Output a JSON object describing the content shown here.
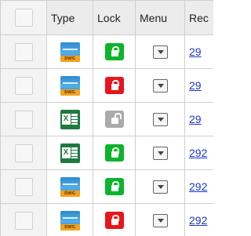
{
  "headers": {
    "select": "",
    "type": "Type",
    "lock": "Lock",
    "menu": "Menu",
    "rec": "Rec"
  },
  "rows": [
    {
      "type": "dwg-icon",
      "type_label": "DWG",
      "lock": "locked",
      "lock_color": "#0bb52a",
      "rec": "29"
    },
    {
      "type": "dwg-icon",
      "type_label": "DWG",
      "lock": "locked",
      "lock_color": "#e6161c",
      "rec": "29"
    },
    {
      "type": "excel-icon",
      "type_label": "X",
      "lock": "unlocked",
      "lock_color": "#aaaaaa",
      "rec": "29"
    },
    {
      "type": "excel-icon",
      "type_label": "X",
      "lock": "locked",
      "lock_color": "#0bb52a",
      "rec": "292"
    },
    {
      "type": "dwg-icon",
      "type_label": "DWG",
      "lock": "locked",
      "lock_color": "#0bb52a",
      "rec": "292"
    },
    {
      "type": "dwg-icon",
      "type_label": "DWG",
      "lock": "locked",
      "lock_color": "#e6161c",
      "rec": "292"
    }
  ]
}
